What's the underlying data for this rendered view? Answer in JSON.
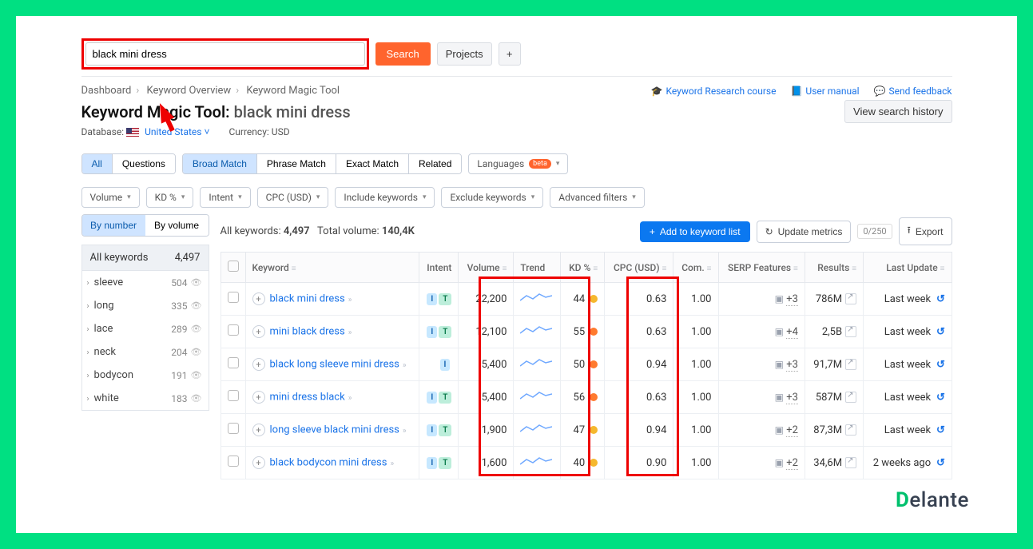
{
  "search": {
    "value": "black mini dress",
    "search_btn": "Search",
    "projects_btn": "Projects"
  },
  "breadcrumbs": [
    "Dashboard",
    "Keyword Overview",
    "Keyword Magic Tool"
  ],
  "toplinks": {
    "course": "Keyword Research course",
    "manual": "User manual",
    "feedback": "Send feedback"
  },
  "title": {
    "tool": "Keyword Magic Tool:",
    "query": "black mini dress",
    "history_btn": "View search history"
  },
  "subhead": {
    "db_label": "Database:",
    "db_value": "United States",
    "cur_label": "Currency:",
    "cur_value": "USD"
  },
  "tabs": {
    "all": "All",
    "questions": "Questions",
    "broad": "Broad Match",
    "phrase": "Phrase Match",
    "exact": "Exact Match",
    "related": "Related",
    "languages": "Languages",
    "beta": "beta"
  },
  "filters": {
    "volume": "Volume",
    "kd": "KD %",
    "intent": "Intent",
    "cpc": "CPC (USD)",
    "include": "Include keywords",
    "exclude": "Exclude keywords",
    "advanced": "Advanced filters"
  },
  "side": {
    "by_number": "By number",
    "by_volume": "By volume",
    "all_label": "All keywords",
    "all_count": "4,497",
    "groups": [
      {
        "name": "sleeve",
        "count": "504"
      },
      {
        "name": "long",
        "count": "335"
      },
      {
        "name": "lace",
        "count": "289"
      },
      {
        "name": "neck",
        "count": "204"
      },
      {
        "name": "bodycon",
        "count": "191"
      },
      {
        "name": "white",
        "count": "183"
      }
    ]
  },
  "meta": {
    "all_kw_label": "All keywords:",
    "all_kw": "4,497",
    "vol_label": "Total volume:",
    "vol": "140,4K"
  },
  "actions": {
    "add": "Add to keyword list",
    "update": "Update metrics",
    "counter": "0/250",
    "export": "Export"
  },
  "columns": {
    "keyword": "Keyword",
    "intent": "Intent",
    "volume": "Volume",
    "trend": "Trend",
    "kd": "KD %",
    "cpc": "CPC (USD)",
    "com": "Com.",
    "serp": "SERP Features",
    "results": "Results",
    "last": "Last Update"
  },
  "rows": [
    {
      "kw": "black mini dress",
      "intent": "IT",
      "vol": "22,200",
      "kd": "44",
      "kdc": "#f5b82e",
      "cpc": "0.63",
      "com": "1.00",
      "sf": "+3",
      "res": "786M",
      "last": "Last week"
    },
    {
      "kw": "mini black dress",
      "intent": "IT",
      "vol": "12,100",
      "kd": "55",
      "kdc": "#ff7a2e",
      "cpc": "0.63",
      "com": "1.00",
      "sf": "+4",
      "res": "2,5B",
      "last": "Last week"
    },
    {
      "kw": "black long sleeve mini dress",
      "intent": "I",
      "vol": "5,400",
      "kd": "50",
      "kdc": "#ff7a2e",
      "cpc": "0.94",
      "com": "1.00",
      "sf": "+3",
      "res": "91,7M",
      "last": "Last week"
    },
    {
      "kw": "mini dress black",
      "intent": "IT",
      "vol": "5,400",
      "kd": "56",
      "kdc": "#ff7a2e",
      "cpc": "0.63",
      "com": "1.00",
      "sf": "+3",
      "res": "587M",
      "last": "Last week"
    },
    {
      "kw": "long sleeve black mini dress",
      "intent": "IT",
      "vol": "1,900",
      "kd": "47",
      "kdc": "#f5b82e",
      "cpc": "0.94",
      "com": "1.00",
      "sf": "+2",
      "res": "87,3M",
      "last": "Last week"
    },
    {
      "kw": "black bodycon mini dress",
      "intent": "IT",
      "vol": "1,600",
      "kd": "40",
      "kdc": "#f5b82e",
      "cpc": "0.90",
      "com": "1.00",
      "sf": "+2",
      "res": "34,6M",
      "last": "2 weeks ago"
    }
  ],
  "brand": "Delante"
}
